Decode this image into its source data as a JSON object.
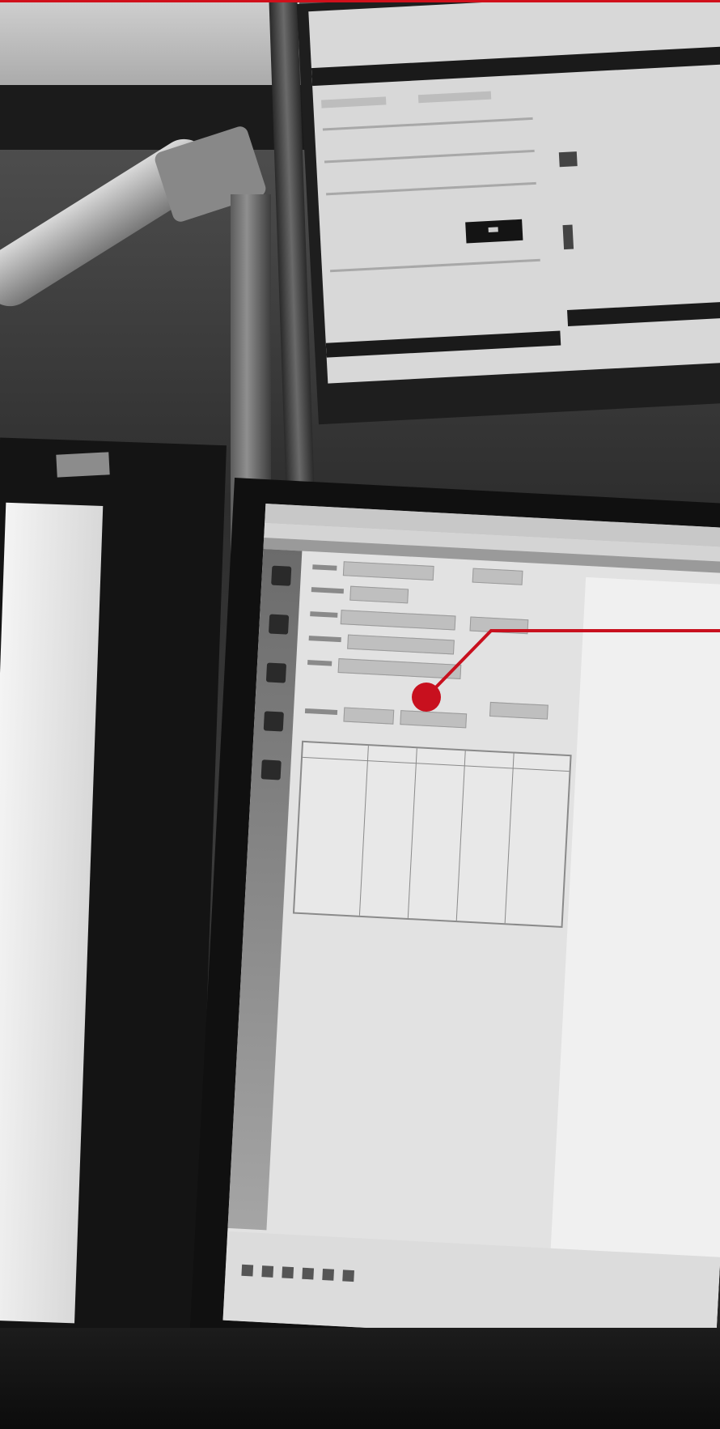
{
  "photo": {
    "subject": "workstation-monitors",
    "style": "grayscale",
    "accent_color": "#c8101e"
  },
  "callout": {
    "color": "#c8101e"
  }
}
